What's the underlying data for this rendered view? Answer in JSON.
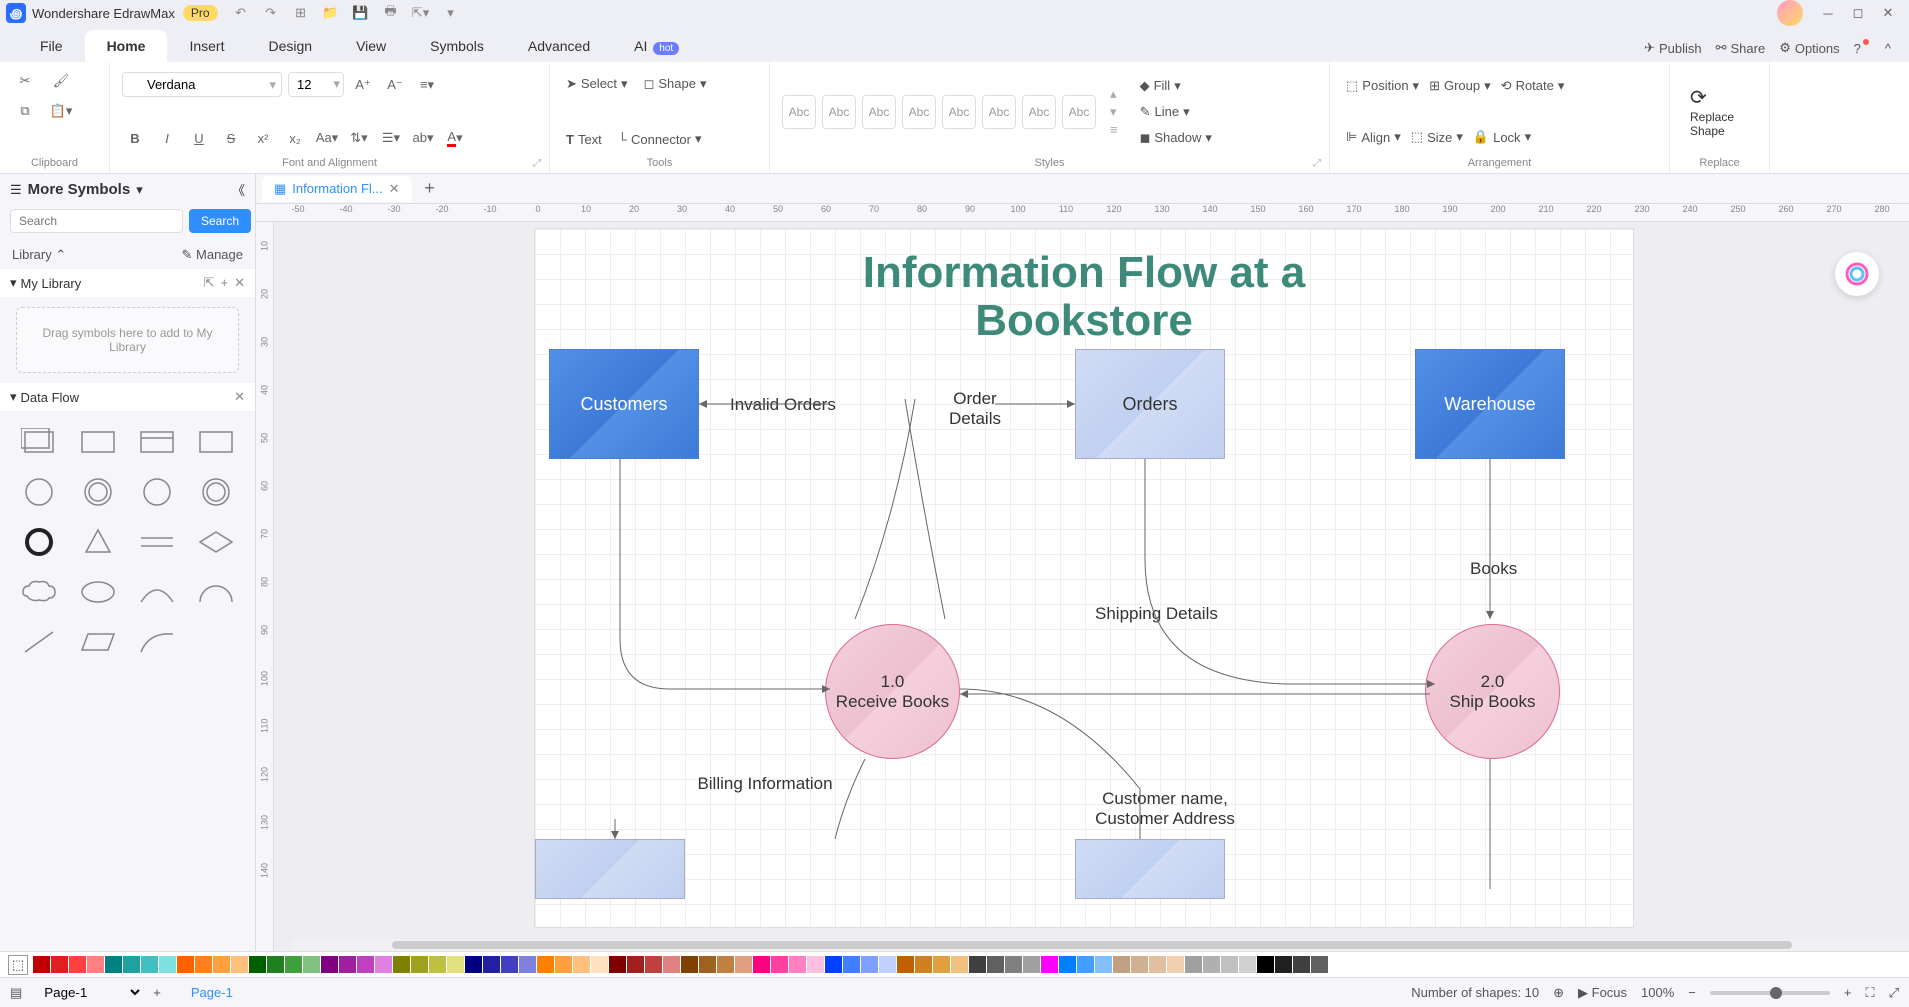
{
  "app": {
    "title": "Wondershare EdrawMax",
    "badge": "Pro"
  },
  "menu": {
    "tabs": [
      "File",
      "Home",
      "Insert",
      "Design",
      "View",
      "Symbols",
      "Advanced",
      "AI"
    ],
    "active": "Home",
    "ai_hot": "hot",
    "right": {
      "publish": "Publish",
      "share": "Share",
      "options": "Options"
    }
  },
  "ribbon": {
    "clipboard": {
      "label": "Clipboard"
    },
    "font": {
      "label": "Font and Alignment",
      "name": "Verdana",
      "size": "12"
    },
    "tools": {
      "label": "Tools",
      "select": "Select",
      "shape": "Shape",
      "text": "Text",
      "connector": "Connector"
    },
    "styles": {
      "label": "Styles",
      "swatch": "Abc",
      "fill": "Fill",
      "line": "Line",
      "shadow": "Shadow"
    },
    "arrangement": {
      "label": "Arrangement",
      "position": "Position",
      "group": "Group",
      "rotate": "Rotate",
      "align": "Align",
      "size": "Size",
      "lock": "Lock"
    },
    "replace": {
      "label": "Replace",
      "button": "Replace\nShape"
    }
  },
  "left_panel": {
    "title": "More Symbols",
    "search_placeholder": "Search",
    "search_btn": "Search",
    "library_label": "Library",
    "manage_label": "Manage",
    "my_library": {
      "title": "My Library",
      "drop_text": "Drag symbols here to add to My Library"
    },
    "data_flow": {
      "title": "Data Flow"
    }
  },
  "document": {
    "tab_name": "Information Fl...",
    "ruler_h": [
      "-50",
      "-40",
      "-30",
      "-20",
      "-10",
      "0",
      "10",
      "20",
      "30",
      "40",
      "50",
      "60",
      "70",
      "80",
      "90",
      "100",
      "110",
      "120",
      "130",
      "140",
      "150",
      "160",
      "170",
      "180",
      "190",
      "200",
      "210",
      "220",
      "230",
      "240",
      "250",
      "260",
      "270",
      "280"
    ],
    "ruler_v": [
      "10",
      "20",
      "30",
      "40",
      "50",
      "60",
      "70",
      "80",
      "90",
      "100",
      "110",
      "120",
      "130",
      "140"
    ]
  },
  "diagram": {
    "title": "Information Flow at a Bookstore",
    "nodes": {
      "customers": "Customers",
      "orders": "Orders",
      "warehouse": "Warehouse",
      "receive": {
        "id": "1.0",
        "label": "Receive Books"
      },
      "ship": {
        "id": "2.0",
        "label": "Ship Books"
      }
    },
    "labels": {
      "invalid": "Invalid Orders",
      "order_details": "Order Details",
      "books": "Books",
      "shipping": "Shipping Details",
      "billing": "Billing Information",
      "customer_addr": "Customer name, Customer Address"
    }
  },
  "status": {
    "page_select": "Page-1",
    "page_tab": "Page-1",
    "shapes": "Number of shapes: 10",
    "focus": "Focus",
    "zoom": "100%"
  },
  "colors": [
    "#c00000",
    "#e02020",
    "#ff4040",
    "#ff8080",
    "#008080",
    "#20a0a0",
    "#40c0c0",
    "#80e0e0",
    "#ff6000",
    "#ff8020",
    "#ffa040",
    "#ffc080",
    "#006000",
    "#208020",
    "#40a040",
    "#80c080",
    "#800080",
    "#a020a0",
    "#c040c0",
    "#e080e0",
    "#808000",
    "#a0a020",
    "#c0c040",
    "#e0e080",
    "#000080",
    "#2020a0",
    "#4040c0",
    "#8080e0",
    "#ff8000",
    "#ffa040",
    "#ffc080",
    "#ffe0c0",
    "#800000",
    "#a02020",
    "#c04040",
    "#e08080",
    "#804000",
    "#a06020",
    "#c08040",
    "#e0a080",
    "#ff0080",
    "#ff40a0",
    "#ff80c0",
    "#ffc0e0",
    "#0040ff",
    "#4080ff",
    "#80a0ff",
    "#c0d0ff",
    "#c06000",
    "#d08020",
    "#e0a040",
    "#f0c080",
    "#404040",
    "#606060",
    "#808080",
    "#a0a0a0",
    "#ff00ff",
    "#0080ff",
    "#40a0ff",
    "#80c0ff",
    "#c0a080",
    "#d0b090",
    "#e0c0a0",
    "#f0d0b0",
    "#a0a0a0",
    "#b0b0b0",
    "#c0c0c0",
    "#d0d0d0",
    "#000000",
    "#202020",
    "#404040",
    "#606060",
    "#ffffff"
  ]
}
